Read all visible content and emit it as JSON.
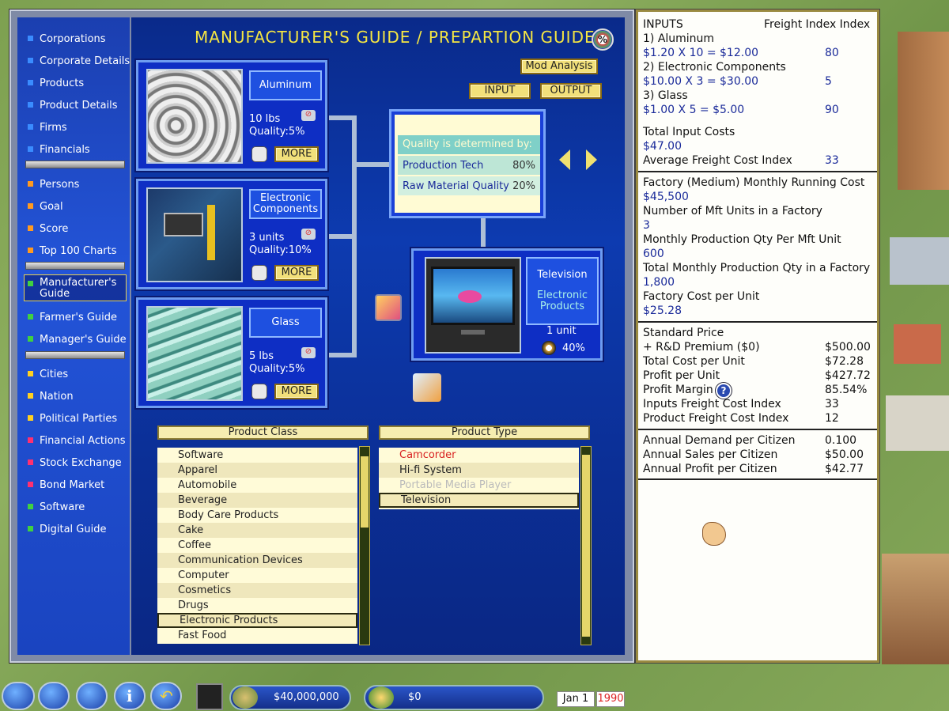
{
  "title": "MANUFACTURER'S GUIDE / PREPARTION GUIDE",
  "pct_icon": "%",
  "nav": [
    {
      "label": "Corporations",
      "color": "#3a8cff"
    },
    {
      "label": "Corporate Details",
      "color": "#3a8cff"
    },
    {
      "label": "Products",
      "color": "#3a8cff"
    },
    {
      "label": "Product Details",
      "color": "#3a8cff"
    },
    {
      "label": "Firms",
      "color": "#3a8cff"
    },
    {
      "label": "Financials",
      "color": "#3a8cff"
    },
    {
      "label": "Persons",
      "color": "#ff9a20"
    },
    {
      "label": "Goal",
      "color": "#ff9a20"
    },
    {
      "label": "Score",
      "color": "#ff9a20"
    },
    {
      "label": "Top 100 Charts",
      "color": "#ff9a20"
    },
    {
      "label": "Manufacturer's Guide",
      "color": "#40d040"
    },
    {
      "label": "Farmer's Guide",
      "color": "#40d040"
    },
    {
      "label": "Manager's Guide",
      "color": "#40d040"
    },
    {
      "label": "Cities",
      "color": "#ffd020"
    },
    {
      "label": "Nation",
      "color": "#ffd020"
    },
    {
      "label": "Political Parties",
      "color": "#ffd020"
    },
    {
      "label": "Financial Actions",
      "color": "#ff3070"
    },
    {
      "label": "Stock Exchange",
      "color": "#ff3070"
    },
    {
      "label": "Bond Market",
      "color": "#ff3070"
    },
    {
      "label": "Software",
      "color": "#40d040"
    },
    {
      "label": "Digital Guide",
      "color": "#40d040"
    }
  ],
  "buttons": {
    "mod_analysis": "Mod Analysis",
    "input": "INPUT",
    "output": "OUTPUT",
    "more": "MORE"
  },
  "inputs": [
    {
      "name": "Aluminum",
      "qty": "10 lbs",
      "quality": "Quality:5%"
    },
    {
      "name": "Electronic Components",
      "qty": "3 units",
      "quality": "Quality:10%"
    },
    {
      "name": "Glass",
      "qty": "5 lbs",
      "quality": "Quality:5%"
    }
  ],
  "quality": {
    "heading": "Quality is determined by:",
    "rows": [
      {
        "label": "Production Tech",
        "value": "80%"
      },
      {
        "label": "Raw Material Quality",
        "value": "20%"
      }
    ]
  },
  "output": {
    "name": "Television",
    "class": "Electronic Products",
    "qty": "1 unit",
    "pct": "40%"
  },
  "product_class": {
    "header": "Product Class",
    "items": [
      "Software",
      "Apparel",
      "Automobile",
      "Beverage",
      "Body Care Products",
      "Cake",
      "Coffee",
      "Communication Devices",
      "Computer",
      "Cosmetics",
      "Drugs",
      "Electronic Products",
      "Fast Food"
    ],
    "selected": "Electronic Products"
  },
  "product_type": {
    "header": "Product Type",
    "items": [
      "Camcorder",
      "Hi-fi System",
      "Portable Media Player",
      "Television"
    ],
    "selected": "Television"
  },
  "right": {
    "inputs_header": "INPUTS",
    "freight_header": "Freight Index Index",
    "in1": "1) Aluminum",
    "in1v": "$1.20 X 10 = $12.00",
    "in1f": "80",
    "in2": "2) Electronic Components",
    "in2v": "$10.00 X 3 = $30.00",
    "in2f": "5",
    "in3": "3) Glass",
    "in3v": "$1.00 X 5 = $5.00",
    "in3f": "90",
    "tic": "Total Input Costs",
    "ticv": "$47.00",
    "afci": "Average Freight Cost Index",
    "afciv": "33",
    "frc": "Factory (Medium) Monthly Running Cost",
    "frcv": "$45,500",
    "nmu": "Number of Mft Units in a Factory",
    "nmuv": "3",
    "mpq": "Monthly Production Qty Per Mft Unit",
    "mpqv": "600",
    "tmpq": "Total Monthly Production Qty in a Factory",
    "tmpqv": "1,800",
    "fcu": "Factory Cost per Unit",
    "fcuv": "$25.28",
    "sp": "Standard Price",
    "rd": "+ R&D Premium ($0)",
    "rdv": "$500.00",
    "tcu": "Total Cost per Unit",
    "tcuv": "$72.28",
    "ppu": "Profit per Unit",
    "ppuv": "$427.72",
    "pm": "Profit Margin",
    "pmv": "85.54%",
    "help": "?",
    "ifci": "Inputs Freight Cost Index",
    "ifciv": "33",
    "pfci": "Product Freight Cost Index",
    "pfciv": "12",
    "adc": "Annual Demand per Citizen",
    "adcv": "0.100",
    "asc": "Annual Sales per Citizen",
    "ascv": "$50.00",
    "apc": "Annual Profit per Citizen",
    "apcv": "$42.77"
  },
  "taskbar": {
    "cash": "$40,000,000",
    "income": "$0",
    "date": "Jan 1",
    "year": "1990"
  }
}
